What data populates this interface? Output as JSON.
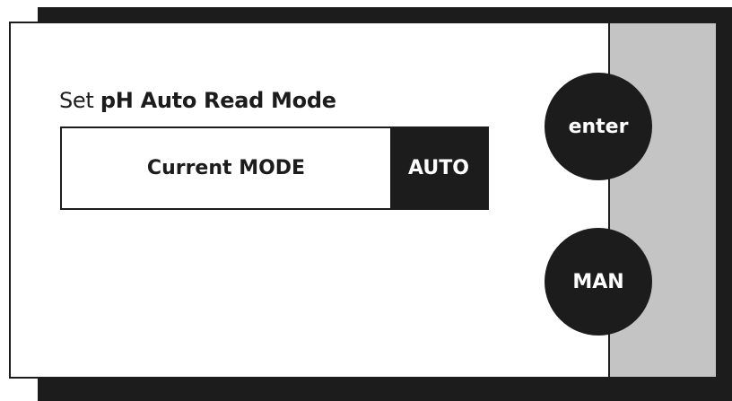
{
  "screen": {
    "title_prefix": "Set",
    "title_bold": "pH Auto Read Mode",
    "mode_label": "Current MODE",
    "mode_value": "AUTO"
  },
  "buttons": {
    "enter_label": "enter",
    "man_label": "MAN"
  },
  "colors": {
    "frame": "#1c1c1c",
    "side_panel": "#c4c4c4",
    "screen_background": "#ffffff"
  }
}
